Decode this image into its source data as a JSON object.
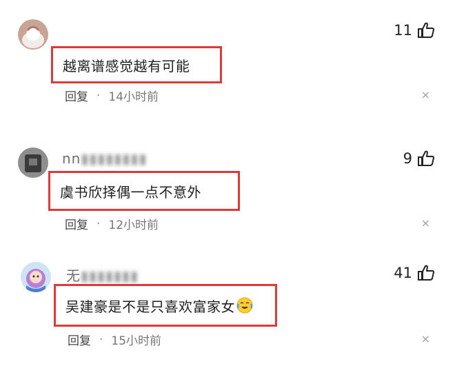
{
  "comments": [
    {
      "username": "",
      "like_count": "11",
      "text": "越离谱感觉越有可能",
      "reply_label": "回复",
      "separator": "·",
      "time": "14小时前",
      "close_glyph": "×",
      "avatar": "avatar-steamed-bun"
    },
    {
      "username": "nn",
      "like_count": "9",
      "text": "虞书欣择偶一点不意外",
      "reply_label": "回复",
      "separator": "·",
      "time": "12小时前",
      "close_glyph": "×",
      "avatar": "avatar-dark-photo"
    },
    {
      "username": "无",
      "like_count": "41",
      "text": "吴建豪是不是只喜欢富家女",
      "reply_label": "回复",
      "separator": "·",
      "time": "15小时前",
      "close_glyph": "×",
      "avatar": "avatar-cartoon-girl",
      "emoji": "crying-laughing-emoji"
    }
  ],
  "colors": {
    "highlight_border": "#e0373b",
    "meta_text": "#777777",
    "like_text": "#222222"
  }
}
